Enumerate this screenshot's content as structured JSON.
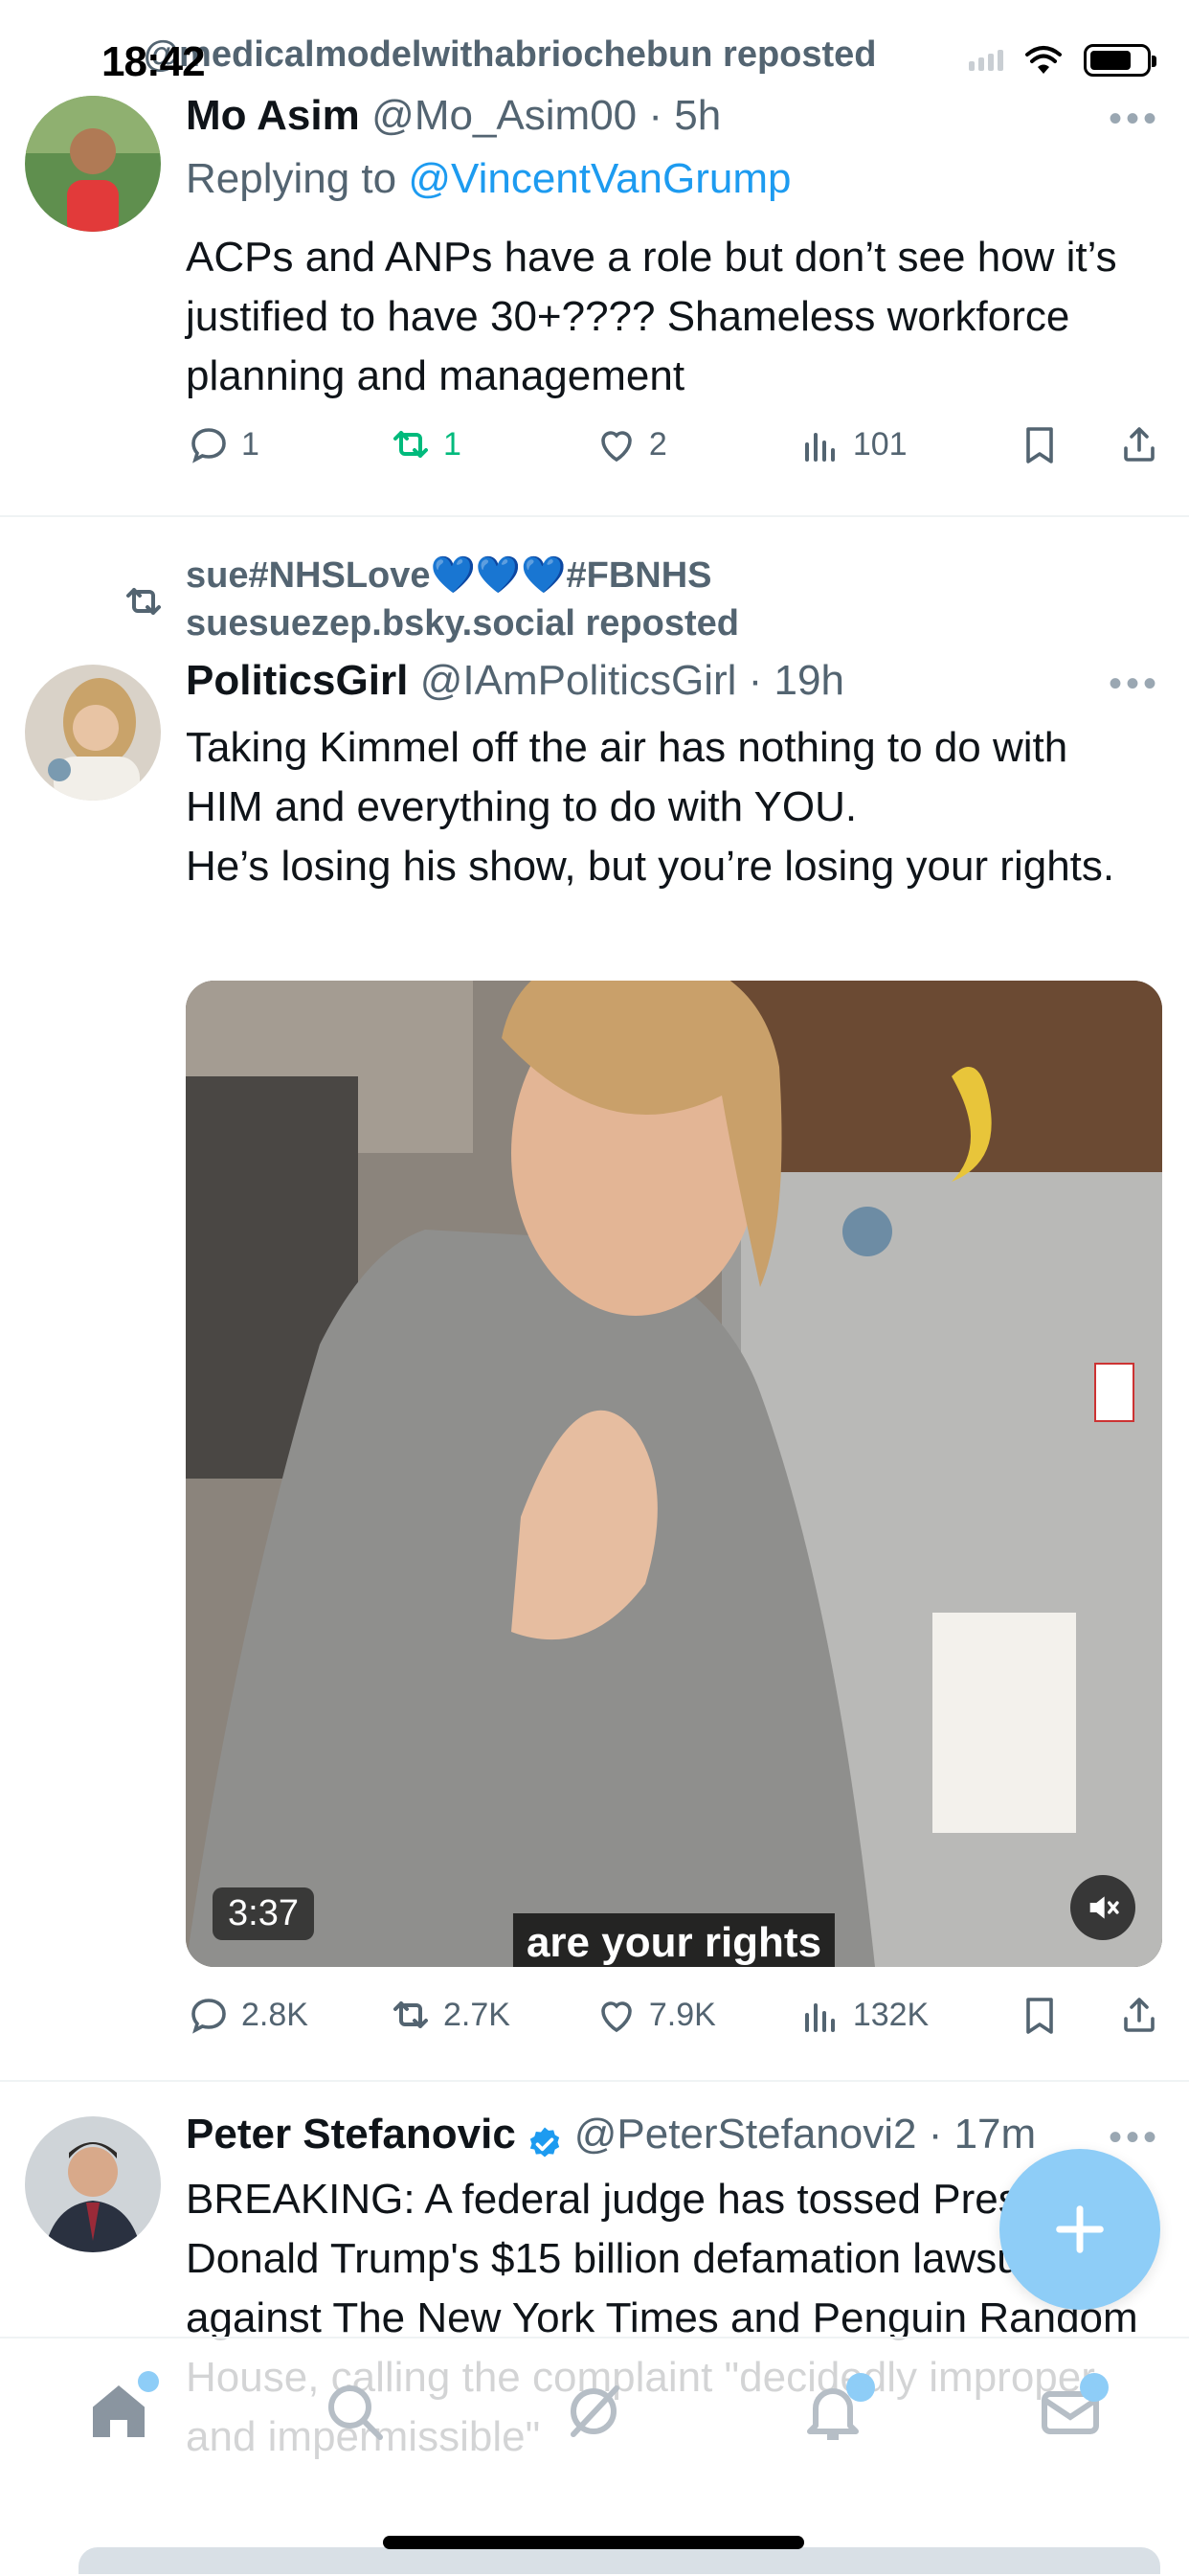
{
  "status_bar": {
    "time": "18:42"
  },
  "top_repost": {
    "text": "@medicalmodelwithabriochebun reposted"
  },
  "tweets": [
    {
      "name": "Mo Asim",
      "handle": "@Mo_Asim00 · 5h",
      "replying_prefix": "Replying to ",
      "replying_to": "@VincentVanGrump",
      "text": "ACPs and ANPs have a role but don’t see how it’s justified to have 30+???? Shameless workforce planning and management",
      "replies": "1",
      "reposts": "1",
      "likes": "2",
      "views": "101"
    },
    {
      "repost_line1": "sue#NHSLove💙💙💙#FBNHS",
      "repost_line2": "suesuezep.bsky.social reposted",
      "name": "PoliticsGirl",
      "handle": "@IAmPoliticsGirl · 19h",
      "text": "Taking Kimmel off the air has nothing to do with HIM and everything to do with YOU.\nHe’s losing his show, but you’re losing your rights.",
      "video_duration": "3:37",
      "video_caption": "are your rights",
      "replies": "2.8K",
      "reposts": "2.7K",
      "likes": "7.9K",
      "views": "132K"
    },
    {
      "name": "Peter Stefanovic",
      "handle": "@PeterStefanovi2 · 17m",
      "text": "BREAKING: A federal judge has tossed President Donald Trump's $15 billion defamation lawsuit against The New York Times and Penguin Random House, calling the complaint \"decidedly improper and impermissible\""
    }
  ],
  "colors": {
    "accent": "#1d9bf0",
    "repost_green": "#00ba7c",
    "muted": "#536471",
    "fab": "#8ecdf7"
  },
  "icons": [
    "reply-icon",
    "repost-icon",
    "like-icon",
    "views-icon",
    "bookmark-icon",
    "share-icon",
    "more-icon",
    "home-icon",
    "search-icon",
    "grok-icon",
    "notifications-icon",
    "messages-icon",
    "compose-icon"
  ]
}
